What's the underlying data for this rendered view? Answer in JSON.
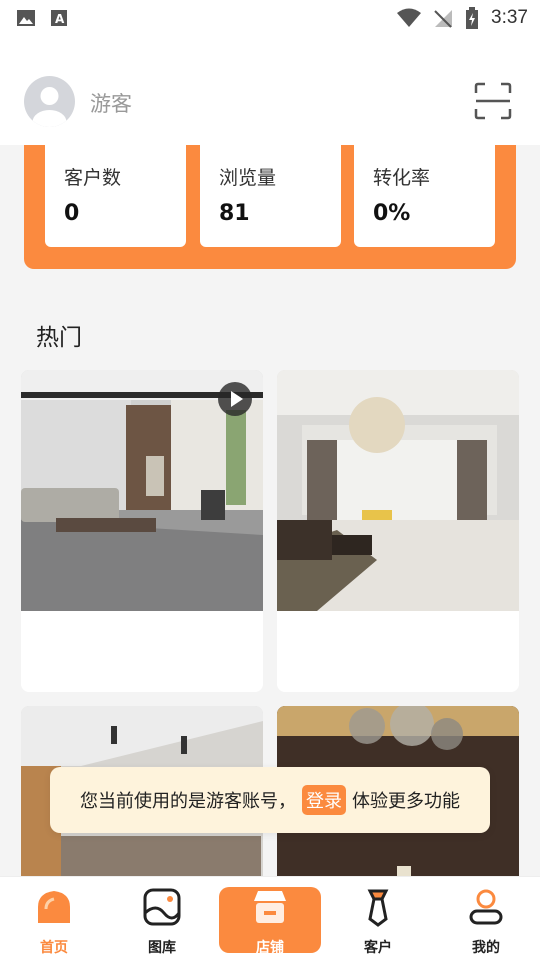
{
  "status_bar": {
    "time": "3:37"
  },
  "header": {
    "username": "游客"
  },
  "stats": [
    {
      "label": "客户数",
      "value": "0"
    },
    {
      "label": "浏览量",
      "value": "81"
    },
    {
      "label": "转化率",
      "value": "0%"
    }
  ],
  "section": {
    "title": "热门"
  },
  "toast": {
    "text_before": "您当前使用的是游客账号，",
    "login": "登录",
    "text_after": "体验更多功能"
  },
  "tabbar": [
    {
      "label": "首页",
      "icon": "home-icon",
      "active": true
    },
    {
      "label": "图库",
      "icon": "gallery-icon",
      "active": false
    },
    {
      "label": "店铺",
      "icon": "store-icon",
      "active": false
    },
    {
      "label": "客户",
      "icon": "tie-icon",
      "active": false
    },
    {
      "label": "我的",
      "icon": "person-icon",
      "active": false
    }
  ],
  "colors": {
    "accent": "#fb8a3f",
    "toast_bg": "#fef3dc"
  }
}
